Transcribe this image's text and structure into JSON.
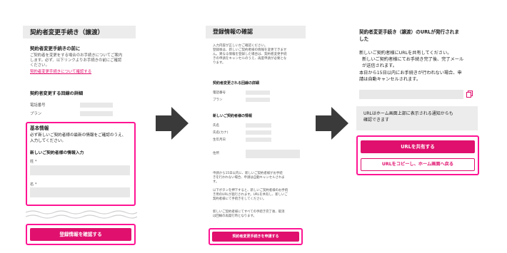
{
  "screen1": {
    "title": "契約者変更手続き（譲渡）",
    "intro_heading": "契約者変更手続きの前に",
    "intro_body": [
      "ご契約者を変更をする場合のお手続きについてご案内",
      "します。必ず、以下リンクよりお手続きの前にご確認",
      "ください。"
    ],
    "intro_link": "契約者変更手続きについて確認する",
    "line_section_title": "契約者変更する回線の詳細",
    "phone_label": "電話番号",
    "plan_label": "プラン",
    "basic_info_heading": "基本情報",
    "basic_info_body": [
      "必ず新しいご契約者様の最新の情報をご確認のうえ、",
      "入力してください。"
    ],
    "new_info_heading": "新しいご契約者様の情報入力",
    "last_name_label": "姓 *",
    "first_name_label": "名 *",
    "confirm_button": "登録情報を確認する"
  },
  "screen2": {
    "title": "登録情報の確認",
    "intro_body": [
      "入力内容が正しいかご確認ください。",
      "登録後は、新しいご契約者様の情報を変更できませ",
      "ん。異なる情報を登録した場合は、契約者変更手続",
      "きの申請をキャンセルのうえ、再度申請が必要とな",
      "ります。"
    ],
    "line_section_title": "契約者変更される回線の詳細",
    "phone_label": "電話番号",
    "plan_label": "プラン",
    "new_section_title": "新しいご契約者様の情報",
    "name_label": "氏名",
    "kana_label": "氏名(カナ)",
    "birthday_label": "生年月日",
    "address_label": "住所",
    "note1": [
      "申請から15日以内に、新しいご契約者様がお手続",
      "きを行われない場合、申請は自動キャンセルされま",
      "す。"
    ],
    "note2": [
      "以下ボタンを押下すると、新しいご契約者様のお手続",
      "き用のURLが発行されます。URLを共有し、新しいご",
      "契約者様にて手続きをしてください。"
    ],
    "note3": [
      "新しいご契約者様にてすべての手続き完了後、取消",
      "は回線の再発行時となります。"
    ],
    "apply_button": "契約者変更手続きを申請する"
  },
  "screen3": {
    "title": [
      "契約者変更手続き（譲渡）のURLが発行されま",
      "した"
    ],
    "body": [
      "新しいご契約者様にURLを共有してください。",
      "新しいご契約者様にてお手続き完了後、完了メール",
      "が送信されます。",
      "本日から15日以内にお手続きが行われない場合、申",
      "請は自動キャンセルされます。"
    ],
    "hint": [
      "URLはホーム画面上部に表示される通知からも",
      "確認できます"
    ],
    "share_button": "URLを共有する",
    "copy_button": "URLをコピーし、ホーム画面へ戻る"
  },
  "colors": {
    "accent": "#e0106e",
    "highlight_frame": "#ff1493",
    "arrow": "#3a3a3a",
    "field": "#e8e8e8"
  }
}
